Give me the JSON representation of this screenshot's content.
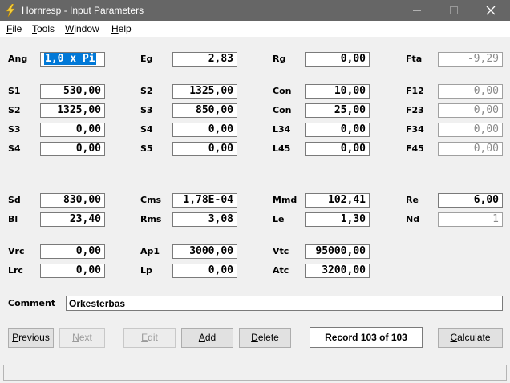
{
  "window": {
    "title": "Hornresp - Input Parameters",
    "titlebar_color": "#666666"
  },
  "menu": [
    {
      "key": "F",
      "rest": "ile"
    },
    {
      "key": "T",
      "rest": "ools"
    },
    {
      "key": "W",
      "rest": "indow"
    },
    {
      "key": "H",
      "rest": "elp"
    }
  ],
  "params": {
    "ang": {
      "label": "Ang",
      "value": "1,0 x Pi"
    },
    "eg": {
      "label": "Eg",
      "value": "2,83"
    },
    "rg": {
      "label": "Rg",
      "value": "0,00"
    },
    "fta": {
      "label": "Fta",
      "value": "-9,29"
    },
    "s1a": {
      "label": "S1",
      "value": "530,00"
    },
    "s2b": {
      "label": "S2",
      "value": "1325,00"
    },
    "con1": {
      "label": "Con",
      "value": "10,00"
    },
    "f12": {
      "label": "F12",
      "value": "0,00"
    },
    "s2a": {
      "label": "S2",
      "value": "1325,00"
    },
    "s3b": {
      "label": "S3",
      "value": "850,00"
    },
    "con2": {
      "label": "Con",
      "value": "25,00"
    },
    "f23": {
      "label": "F23",
      "value": "0,00"
    },
    "s3a": {
      "label": "S3",
      "value": "0,00"
    },
    "s4b": {
      "label": "S4",
      "value": "0,00"
    },
    "l34": {
      "label": "L34",
      "value": "0,00"
    },
    "f34": {
      "label": "F34",
      "value": "0,00"
    },
    "s4a": {
      "label": "S4",
      "value": "0,00"
    },
    "s5b": {
      "label": "S5",
      "value": "0,00"
    },
    "l45": {
      "label": "L45",
      "value": "0,00"
    },
    "f45": {
      "label": "F45",
      "value": "0,00"
    },
    "sd": {
      "label": "Sd",
      "value": "830,00"
    },
    "cms": {
      "label": "Cms",
      "value": "1,78E-04"
    },
    "mmd": {
      "label": "Mmd",
      "value": "102,41"
    },
    "re": {
      "label": "Re",
      "value": "6,00"
    },
    "bl": {
      "label": "Bl",
      "value": "23,40"
    },
    "rms": {
      "label": "Rms",
      "value": "3,08"
    },
    "le": {
      "label": "Le",
      "value": "1,30"
    },
    "nd": {
      "label": "Nd",
      "value": "1"
    },
    "vrc": {
      "label": "Vrc",
      "value": "0,00"
    },
    "ap1": {
      "label": "Ap1",
      "value": "3000,00"
    },
    "vtc": {
      "label": "Vtc",
      "value": "95000,00"
    },
    "lrc": {
      "label": "Lrc",
      "value": "0,00"
    },
    "lp": {
      "label": "Lp",
      "value": "0,00"
    },
    "atc": {
      "label": "Atc",
      "value": "3200,00"
    }
  },
  "comment": {
    "label": "Comment",
    "value": "Orkesterbas"
  },
  "buttons": {
    "previous": {
      "key": "P",
      "rest": "revious"
    },
    "next": {
      "key": "N",
      "rest": "ext"
    },
    "edit": {
      "key": "E",
      "rest": "dit"
    },
    "add": {
      "key": "A",
      "rest": "dd"
    },
    "delete": {
      "key": "D",
      "rest": "elete"
    },
    "calculate": {
      "key": "C",
      "rest": "alculate"
    }
  },
  "record": "Record 103 of 103",
  "colors": {
    "selection": "#0078d7",
    "background": "#f0f0f0"
  }
}
